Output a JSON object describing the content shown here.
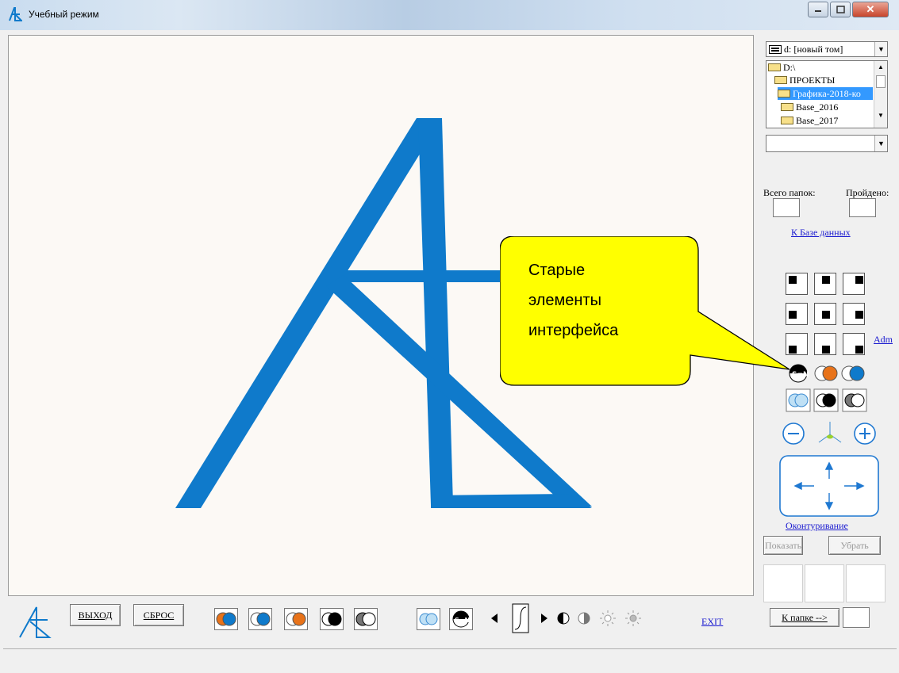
{
  "window": {
    "title": "Учебный режим",
    "icon": "ae-logo-icon",
    "controls": [
      "minimize-icon",
      "maximize-icon",
      "close-icon"
    ]
  },
  "colors": {
    "logo_blue": "#0f7acb",
    "callout_yellow": "#ffff00",
    "link_blue": "#1a1ad0",
    "accent_orange": "#e8731a",
    "canvas_bg": "#fcf9f5"
  },
  "right_panel": {
    "drive_select": "d: [новый том]",
    "tree": [
      "D:\\",
      "ПРОЕКТЫ",
      "Графика-2018-ко",
      "Base_2016",
      "Base_2017"
    ],
    "selected_tree_item": "Графика-2018-ко",
    "folder_select": "",
    "total_folders_label": "Всего папок:",
    "passed_label": "Пройдено:",
    "total_folders_value": "",
    "passed_value": "",
    "db_link": "К Базе данных",
    "adm_link": "Adm",
    "contour_link": "Оконтуривание",
    "show_button": "Показать",
    "remove_button": "Убрать",
    "to_folder_button": "К папке -->",
    "to_folder_value": ""
  },
  "callout": {
    "lines": [
      "Старые",
      "элементы",
      "интерфейса"
    ]
  },
  "bottom": {
    "exit_button": "ВЫХОД",
    "reset_button": "СБРОС",
    "exit_link": "EXIT"
  }
}
